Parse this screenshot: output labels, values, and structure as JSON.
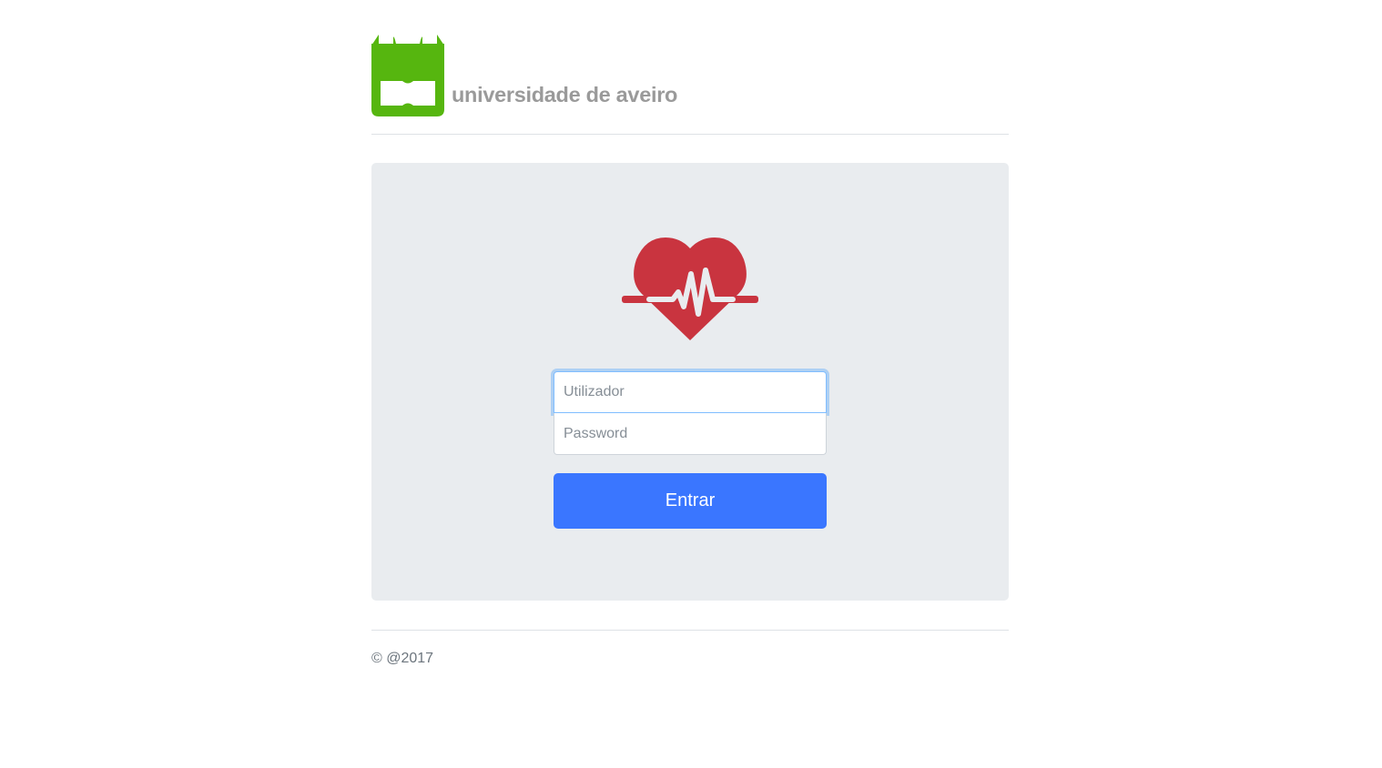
{
  "header": {
    "logo_text": "universidade de aveiro",
    "logo_icon": "ua-logo-icon",
    "logo_color": "#56b60f"
  },
  "login": {
    "heart_icon": "heartbeat-icon",
    "heart_color": "#c9343f",
    "username_placeholder": "Utilizador",
    "username_value": "",
    "password_placeholder": "Password",
    "password_value": "",
    "submit_label": "Entrar",
    "accent_color": "#3a76ff"
  },
  "footer": {
    "copyright": "© @2017"
  }
}
